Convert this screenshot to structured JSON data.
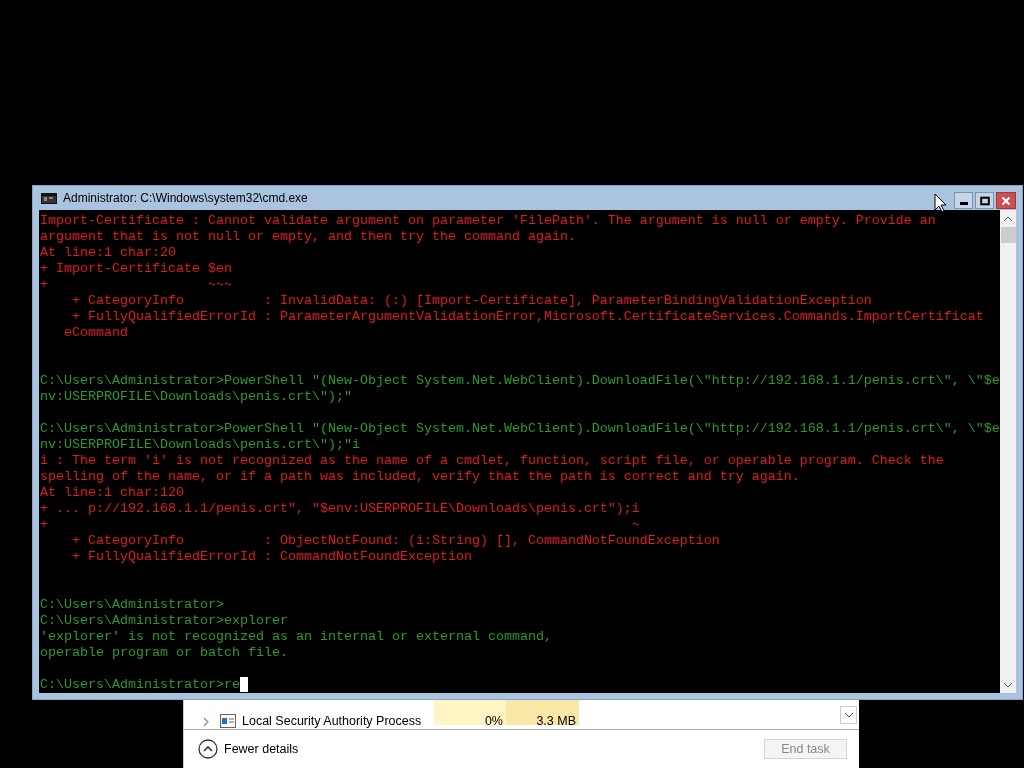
{
  "console_window": {
    "title": "Administrator: C:\\Windows\\system32\\cmd.exe",
    "lines": [
      {
        "kind": "error",
        "text": "Import-Certificate : Cannot validate argument on parameter 'FilePath'. The argument is null or empty. Provide an"
      },
      {
        "kind": "error",
        "text": "argument that is not null or empty, and then try the command again."
      },
      {
        "kind": "error",
        "text": "At line:1 char:20"
      },
      {
        "kind": "error",
        "text": "+ Import-Certificate $en"
      },
      {
        "kind": "error",
        "text": "+                    ~~~"
      },
      {
        "kind": "error",
        "text": "    + CategoryInfo          : InvalidData: (:) [Import-Certificate], ParameterBindingValidationException"
      },
      {
        "kind": "error",
        "text": "    + FullyQualifiedErrorId : ParameterArgumentValidationError,Microsoft.CertificateServices.Commands.ImportCertificat"
      },
      {
        "kind": "error",
        "text": "   eCommand"
      },
      {
        "kind": "blank"
      },
      {
        "kind": "blank"
      },
      {
        "kind": "output",
        "text": "C:\\Users\\Administrator>PowerShell \"(New-Object System.Net.WebClient).DownloadFile(\\\"http://192.168.1.1/penis.crt\\\", \\\"$e"
      },
      {
        "kind": "output",
        "text": "nv:USERPROFILE\\Downloads\\penis.crt\\\");\""
      },
      {
        "kind": "blank"
      },
      {
        "kind": "output",
        "text": "C:\\Users\\Administrator>PowerShell \"(New-Object System.Net.WebClient).DownloadFile(\\\"http://192.168.1.1/penis.crt\\\", \\\"$e"
      },
      {
        "kind": "output",
        "text": "nv:USERPROFILE\\Downloads\\penis.crt\\\");\"i"
      },
      {
        "kind": "error",
        "text": "i : The term 'i' is not recognized as the name of a cmdlet, function, script file, or operable program. Check the"
      },
      {
        "kind": "error",
        "text": "spelling of the name, or if a path was included, verify that the path is correct and try again."
      },
      {
        "kind": "error",
        "text": "At line:1 char:120"
      },
      {
        "kind": "error",
        "text": "+ ... p://192.168.1.1/penis.crt\", \"$env:USERPROFILE\\Downloads\\penis.crt\");i"
      },
      {
        "kind": "error",
        "text": "+                                                                         ~"
      },
      {
        "kind": "error",
        "text": "    + CategoryInfo          : ObjectNotFound: (i:String) [], CommandNotFoundException"
      },
      {
        "kind": "error",
        "text": "    + FullyQualifiedErrorId : CommandNotFoundException"
      },
      {
        "kind": "blank"
      },
      {
        "kind": "blank"
      },
      {
        "kind": "output",
        "text": "C:\\Users\\Administrator>"
      },
      {
        "kind": "output",
        "text": "C:\\Users\\Administrator>explorer"
      },
      {
        "kind": "output",
        "text": "'explorer' is not recognized as an internal or external command,"
      },
      {
        "kind": "output",
        "text": "operable program or batch file."
      },
      {
        "kind": "blank"
      }
    ],
    "prompt": "C:\\Users\\Administrator>re"
  },
  "task_manager": {
    "process_row": {
      "name": "Local Security Authority Process",
      "cpu": "0%",
      "memory": "3.3 MB"
    },
    "details_toggle": "Fewer details",
    "end_task": {
      "label": "End task",
      "disabled": true
    }
  }
}
